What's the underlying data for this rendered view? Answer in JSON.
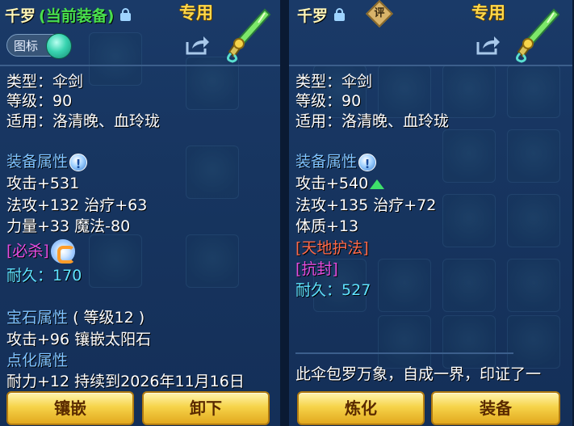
{
  "left": {
    "item_name": "千罗",
    "equip_tag": "(当前装备)",
    "exclusive": "专用",
    "icon_toggle_label": "图标",
    "type_line": "类型：伞剑",
    "level_line": "等级：90",
    "suitable_line": "适用：洛清晚、血玲珑",
    "attr_title": "装备属性",
    "attr_lines": [
      "攻击+531",
      "法攻+132 治疗+63",
      "力量+33 魔法-80"
    ],
    "special": "[必杀]",
    "durability_label": "耐久：",
    "durability_value": "170",
    "gem_title": "宝石属性",
    "gem_level": "( 等级12 )",
    "gem_line": "攻击+96 镶嵌太阳石",
    "refine_title": "点化属性",
    "refine_line": "耐力+12 持续到2026年11月16日",
    "buttons": [
      "镶嵌",
      "卸下"
    ]
  },
  "right": {
    "item_name": "千罗",
    "eval_badge": "评",
    "exclusive": "专用",
    "type_line": "类型：伞剑",
    "level_line": "等级：90",
    "suitable_line": "适用：洛清晚、血玲珑",
    "attr_title": "装备属性",
    "attack_line": "攻击+540",
    "attr_lines": [
      "法攻+135 治疗+72",
      "体质+13"
    ],
    "special_1": "[天地护法]",
    "special_2": "[抗封]",
    "durability_label": "耐久：",
    "durability_value": "527",
    "description": "此伞包罗万象，自成一界，印证了一",
    "buttons": [
      "炼化",
      "装备"
    ]
  },
  "colors": {
    "panel_bg": "#173560",
    "exclusive": "#ffd84a",
    "section": "#7fc3ff",
    "durability": "#5fe3ff",
    "special_red": "#ff6a4a",
    "special_magenta": "#e64de0",
    "equip_tag": "#49e04d",
    "button": "#f6d44a"
  },
  "icons": [
    "lock-icon",
    "eval-icon",
    "share-icon",
    "weapon-icon",
    "info-icon",
    "crit-skill-icon",
    "up-arrow-icon",
    "toggle-knob"
  ]
}
